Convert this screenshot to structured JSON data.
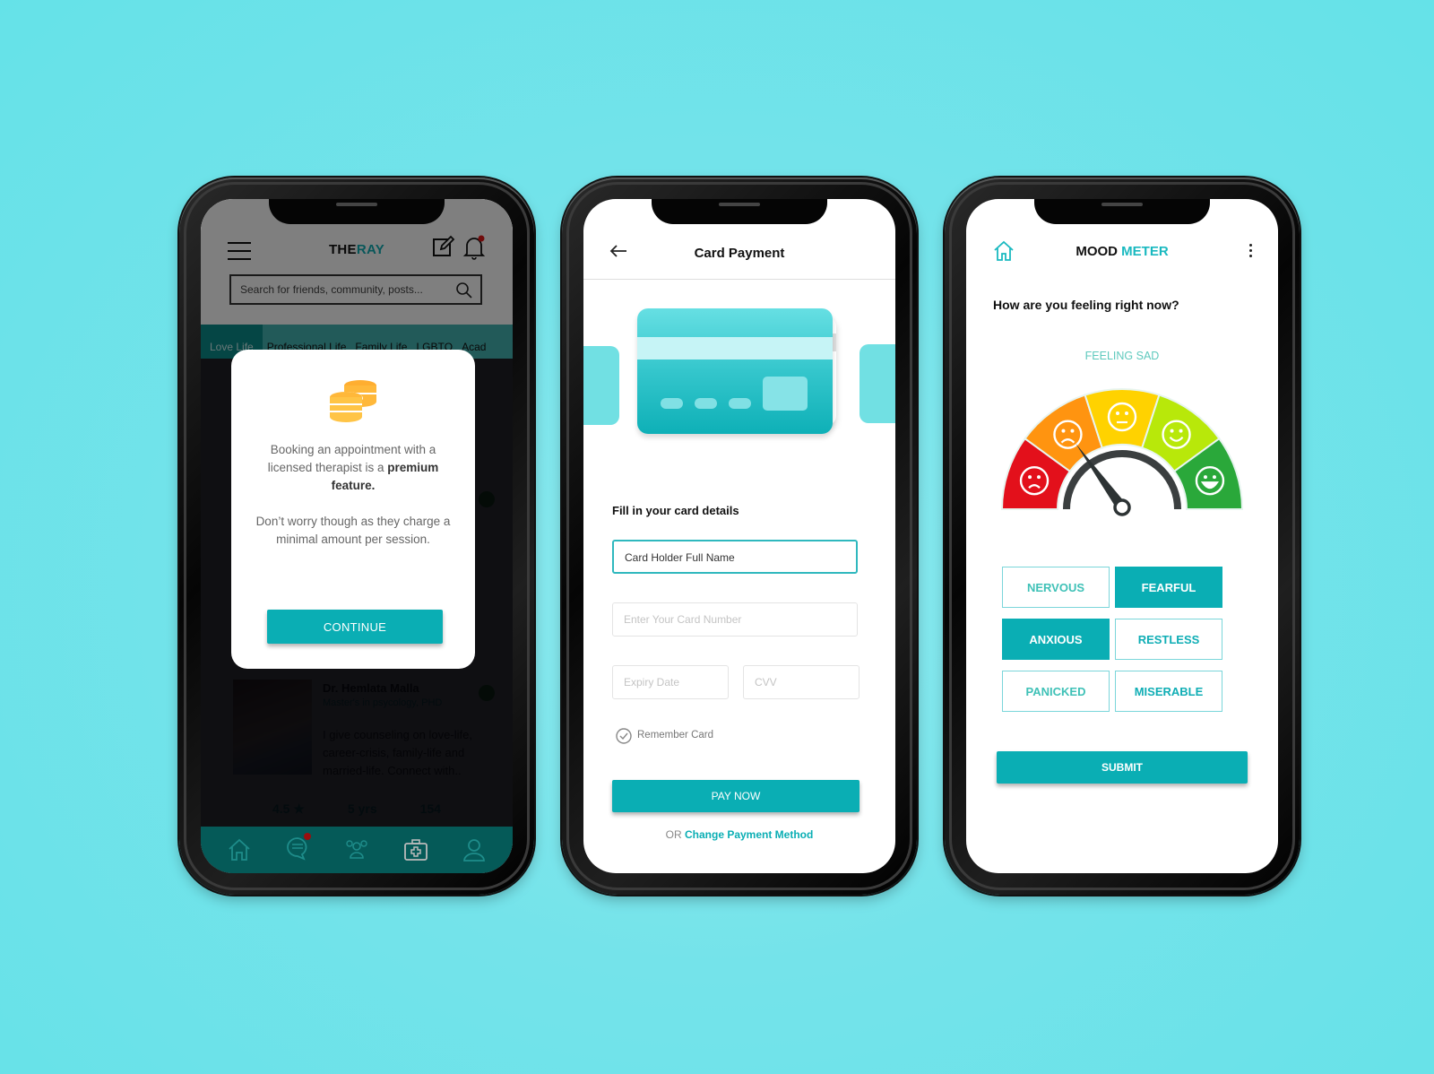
{
  "colors": {
    "background": "#6ae3e8",
    "accent": "#0aaeb4",
    "coin": "#ffb83a",
    "verified": "#1fae2e",
    "notification": "#e01616"
  },
  "phone1": {
    "header": {
      "logo_part1": "THE",
      "logo_part2": "RAY",
      "menu_icon": "hamburger-icon",
      "edit_icon": "edit-icon",
      "bell_icon": "bell-icon"
    },
    "search": {
      "placeholder": "Search for friends, community, posts..."
    },
    "tabs": [
      {
        "label": "Love Life",
        "active": true
      },
      {
        "label": "Professional Life",
        "active": false
      },
      {
        "label": "Family Life",
        "active": false
      },
      {
        "label": "LGBTQ",
        "active": false
      },
      {
        "label": "Acad",
        "active": false
      }
    ],
    "therapist": {
      "name": "Dr. Hemlata Malla",
      "degree": "Master's in psycology, PHD",
      "bio": "I give counseling on love-life, career-crisis, family-life and married-life. Connect with..",
      "rating": "4.5 ★",
      "experience": "5 yrs",
      "count": "154"
    },
    "bottom_nav": [
      "home-icon",
      "chat-icon",
      "community-icon",
      "medical-kit-icon",
      "profile-icon"
    ],
    "modal": {
      "text_line1": "Booking an appointment with a licensed therapist is a ",
      "text_bold": "premium feature.",
      "text2": "Don’t worry though as they charge a minimal amount per session.",
      "button": "CONTINUE"
    }
  },
  "phone2": {
    "title": "Card Payment",
    "subtitle": "Fill in your card details",
    "fields": {
      "name_value": "Card Holder Full Name",
      "number_placeholder": "Enter Your Card Number",
      "expiry_placeholder": "Expiry Date",
      "cvv_placeholder": "CVV"
    },
    "remember_label": "Remember Card",
    "pay_button": "PAY NOW",
    "alt_prefix": "OR ",
    "alt_link": "Change Payment Method"
  },
  "phone3": {
    "title_part1": "MOOD ",
    "title_part2": "METER",
    "question": "How are you feeling right now?",
    "status": "FEELING SAD",
    "gauge": {
      "segments": [
        "very-sad",
        "sad",
        "neutral",
        "happy",
        "very-happy"
      ],
      "segment_colors": [
        "#e3101b",
        "#ff9410",
        "#ffd200",
        "#b8e80a",
        "#2aa83a"
      ],
      "needle_level": 0.3
    },
    "moods": [
      {
        "label": "NERVOUS",
        "selected": false
      },
      {
        "label": "FEARFUL",
        "selected": true
      },
      {
        "label": "ANXIOUS",
        "selected": true
      },
      {
        "label": "RESTLESS",
        "selected": false
      },
      {
        "label": "PANICKED",
        "selected": false
      },
      {
        "label": "MISERABLE",
        "selected": false
      }
    ],
    "submit": "SUBMIT"
  }
}
